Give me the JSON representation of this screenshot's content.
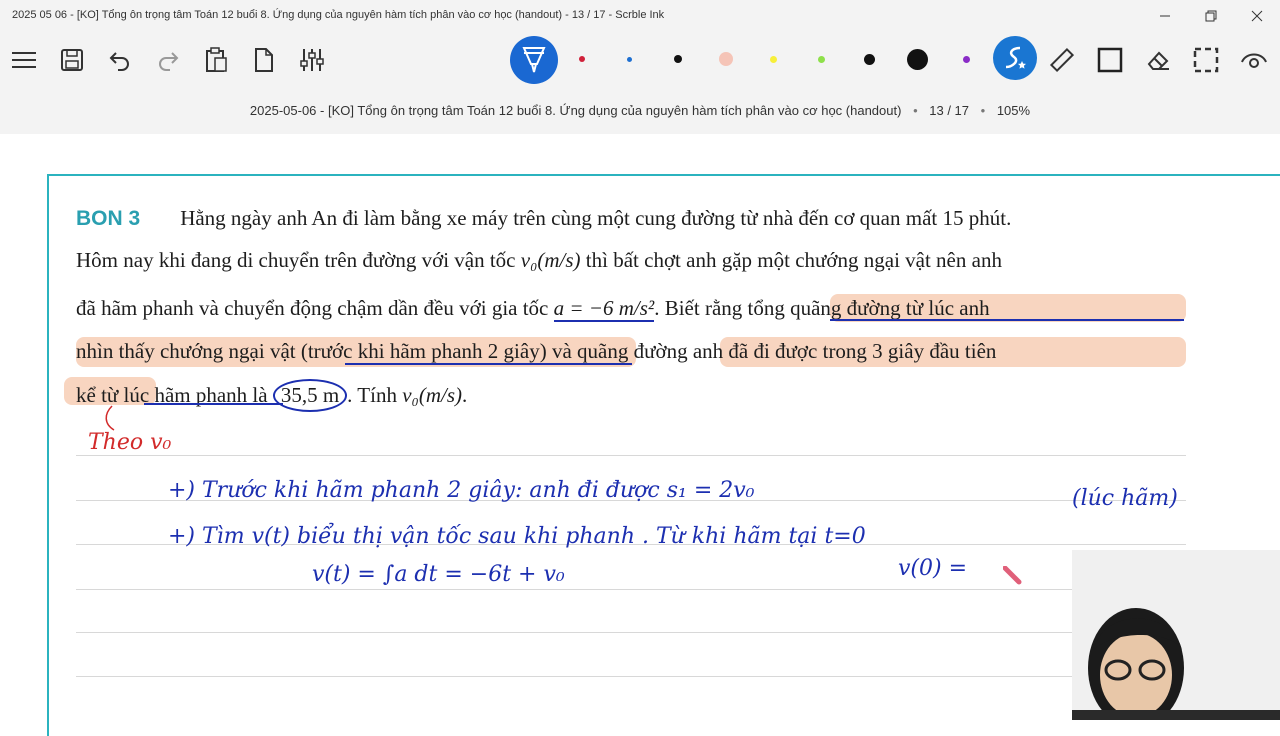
{
  "window": {
    "title": "2025 05 06 - [KO] Tổng ôn trọng tâm Toán 12 buổi 8. Ứng dụng của nguyên hàm tích phân vào cơ học (handout) - 13 / 17 - Scrble Ink",
    "minimize_icon": "minimize-icon",
    "maximize_icon": "restore-icon",
    "close_icon": "close-icon"
  },
  "toolbar": {
    "icons": [
      "menu-icon",
      "save-icon",
      "undo-icon",
      "redo-icon",
      "clipboard-icon",
      "new-page-icon",
      "settings-sliders-icon"
    ],
    "pen_colors": [
      "#d0213a",
      "#1d6fd1",
      "#111111",
      "#f5c4b7",
      "#f7ef3a",
      "#8ee04a",
      "#111111",
      "#111111",
      "#8a2cc7"
    ],
    "right_icons": [
      "magic-pen-icon",
      "ruler-icon",
      "rectangle-icon",
      "eraser-icon",
      "lasso-select-icon",
      "view-icon"
    ],
    "active_pen_color": "#1a68d2"
  },
  "doc": {
    "name": "2025-05-06 - [KO] Tổng ôn trọng tâm Toán 12 buổi 8. Ứng dụng của nguyên hàm tích phân vào cơ học (handout)",
    "page": "13 / 17",
    "zoom": "105%"
  },
  "problem": {
    "label": "BON 3",
    "line1": "Hằng ngày anh An đi làm bằng xe máy trên cùng một cung đường từ nhà đến cơ quan mất 15 phút.",
    "line2a": "Hôm nay khi đang di chuyển trên đường với vận tốc ",
    "line2m": "v₀(m/s)",
    "line2b": " thì bất chợt anh gặp một chướng ngại vật nên anh",
    "line3a": "đã hãm phanh và chuyển động chậm dần đều với gia tốc ",
    "line3m": "a = −6 m/s²",
    "line3b": ". Biết rằng tổng quãng đường từ lúc anh",
    "line4": "nhìn thấy chướng ngại vật (trước khi hãm phanh 2 giây) và quãng đường anh đã đi được trong 3 giây đầu tiên",
    "line5a": "kể từ lúc hãm phanh là ",
    "line5m": "35,5 m",
    "line5b": ". Tính ",
    "line5c": "v₀(m/s)",
    "line5d": "."
  },
  "handwriting": {
    "red_note": "Theo v₀",
    "line1": "+)  Trước khi hãm phanh 2 giây: anh đi được  s₁ = 2v₀",
    "line1_right": "(lúc hãm)",
    "line2": "+)  Tìm v(t)  biểu thị vận tốc sau khi phanh .  Từ khi hãm tại  t=0",
    "line3": "v(t) = ∫a dt   = −6t + v₀",
    "line3_right": "v(0) ="
  }
}
